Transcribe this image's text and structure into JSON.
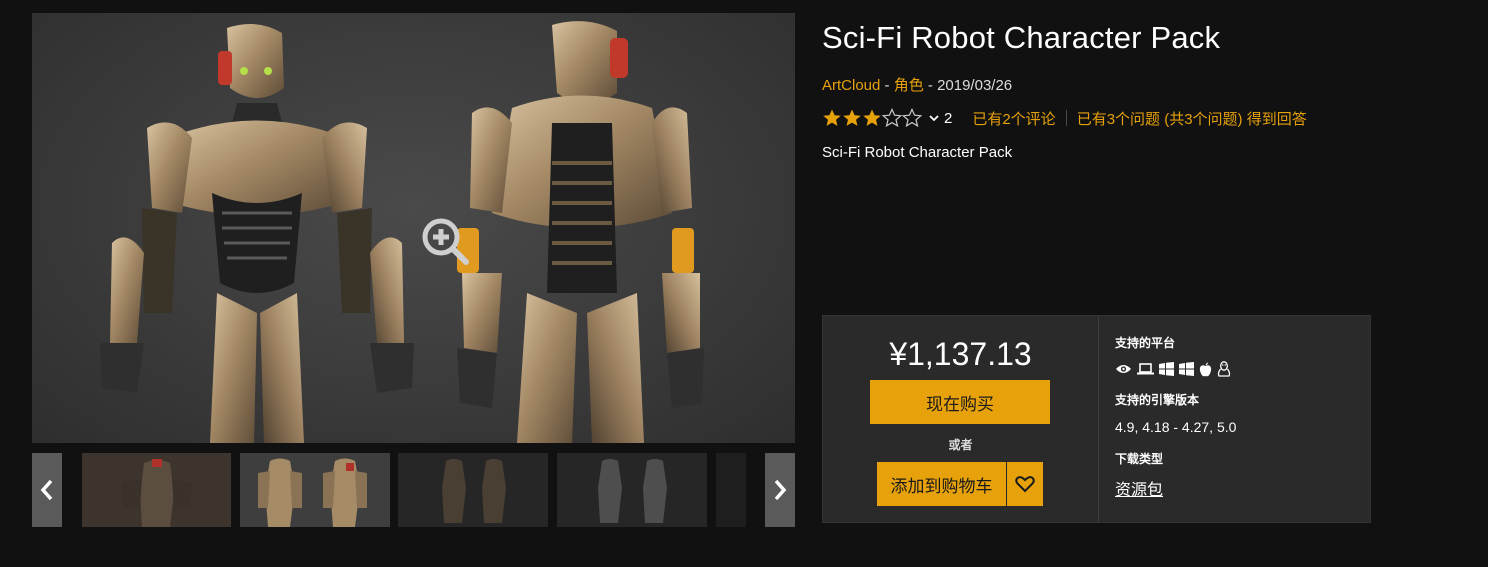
{
  "product": {
    "title": "Sci-Fi Robot Character Pack",
    "publisher": "ArtCloud",
    "category": "角色",
    "date": "2019/03/26",
    "meta_separator": " - ",
    "rating_value": 3,
    "rating_max": 5,
    "rating_count": "2",
    "reviews_link": "已有2个评论",
    "questions_link": "已有3个问题 (共3个问题) 得到回答",
    "subtitle": "Sci-Fi Robot Character Pack"
  },
  "gallery": {
    "zoom_icon": "zoom-in-icon",
    "prev_icon": "chevron-left-icon",
    "next_icon": "chevron-right-icon"
  },
  "purchase": {
    "price": "¥1,137.13",
    "buy_label": "现在购买",
    "or_label": "或者",
    "cart_label": "添加到购物车",
    "wishlist_icon": "heart-icon"
  },
  "specs": {
    "platforms_label": "支持的平台",
    "platforms": [
      "eye-icon",
      "laptop-icon",
      "windows-icon",
      "windows-icon",
      "apple-icon",
      "linux-icon"
    ],
    "engine_label": "支持的引擎版本",
    "engine_versions": "4.9, 4.18 - 4.27, 5.0",
    "download_label": "下载类型",
    "download_type": "资源包"
  },
  "colors": {
    "accent": "#e6a10b",
    "background": "#111111",
    "panel": "#2a2a2a"
  }
}
